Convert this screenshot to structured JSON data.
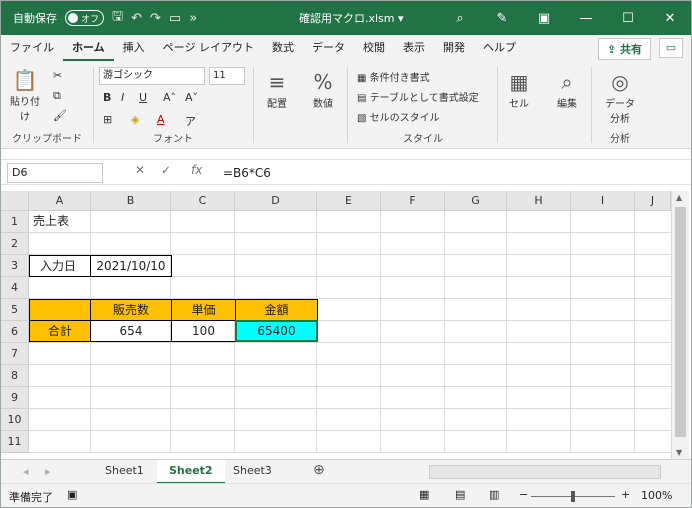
{
  "titlebar": {
    "autosave_label": "自動保存",
    "autosave_state": "オフ",
    "filename": "確認用マクロ.xlsm",
    "more": "»"
  },
  "menu": {
    "tabs": [
      "ファイル",
      "ホーム",
      "挿入",
      "ページ レイアウト",
      "数式",
      "データ",
      "校閲",
      "表示",
      "開発",
      "ヘルプ"
    ],
    "active": "ホーム",
    "share_label": "共有"
  },
  "ribbon": {
    "paste_label": "貼り付け",
    "clipboard_group": "クリップボード",
    "font_name": "游ゴシック",
    "font_size": "11",
    "font_group": "フォント",
    "align_label": "配置",
    "number_label": "数値",
    "style_items": [
      "条件付き書式",
      "テーブルとして書式設定",
      "セルのスタイル"
    ],
    "style_group": "スタイル",
    "cell_label": "セル",
    "edit_label": "編集",
    "analysis_label": "データ分析",
    "analysis_group": "分析"
  },
  "formula_bar": {
    "name_box": "D6",
    "fx": "fx",
    "formula": "=B6*C6"
  },
  "grid": {
    "columns": [
      "A",
      "B",
      "C",
      "D",
      "E",
      "F",
      "G",
      "H",
      "I",
      "J"
    ],
    "rows": [
      "1",
      "2",
      "3",
      "4",
      "5",
      "6",
      "7",
      "8",
      "9",
      "10",
      "11"
    ],
    "cells": {
      "A1": "売上表",
      "A3": "入力日",
      "B3": "2021/10/10",
      "B5": "販売数",
      "C5": "単価",
      "D5": "金額",
      "A6": "合計",
      "B6": "654",
      "C6": "100",
      "D6": "65400"
    },
    "colors": {
      "header_fill": "#FFC000",
      "selected_fill": "#00FFFF"
    }
  },
  "sheets": {
    "tabs": [
      "Sheet1",
      "Sheet2",
      "Sheet3"
    ],
    "active": "Sheet2"
  },
  "status": {
    "ready": "準備完了",
    "zoom": "100%"
  }
}
